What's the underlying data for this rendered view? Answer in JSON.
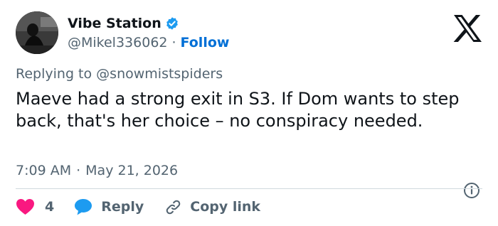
{
  "user": {
    "display_name": "Vibe Station",
    "handle": "@Mikel336062",
    "separator": "·",
    "follow_label": "Follow"
  },
  "reply": {
    "prefix": "Replying to",
    "mention": "@snowmistspiders"
  },
  "tweet": {
    "text": "Maeve had a strong exit in S3. If Dom wants to step back, that's her choice – no conspiracy needed.",
    "time": "7:09 AM",
    "separator": "·",
    "date": "May 21, 2026"
  },
  "actions": {
    "like_count": "4",
    "reply_label": "Reply",
    "copy_link_label": "Copy link"
  },
  "colors": {
    "accent": "#1d9bf0",
    "follow": "#006fd6",
    "like": "#f91880",
    "muted": "#536471",
    "text": "#0f1419",
    "divider": "#cfd9de"
  },
  "icons": [
    "verified-badge-icon",
    "x-logo-icon",
    "info-icon",
    "heart-icon",
    "reply-bubble-icon",
    "link-icon"
  ]
}
